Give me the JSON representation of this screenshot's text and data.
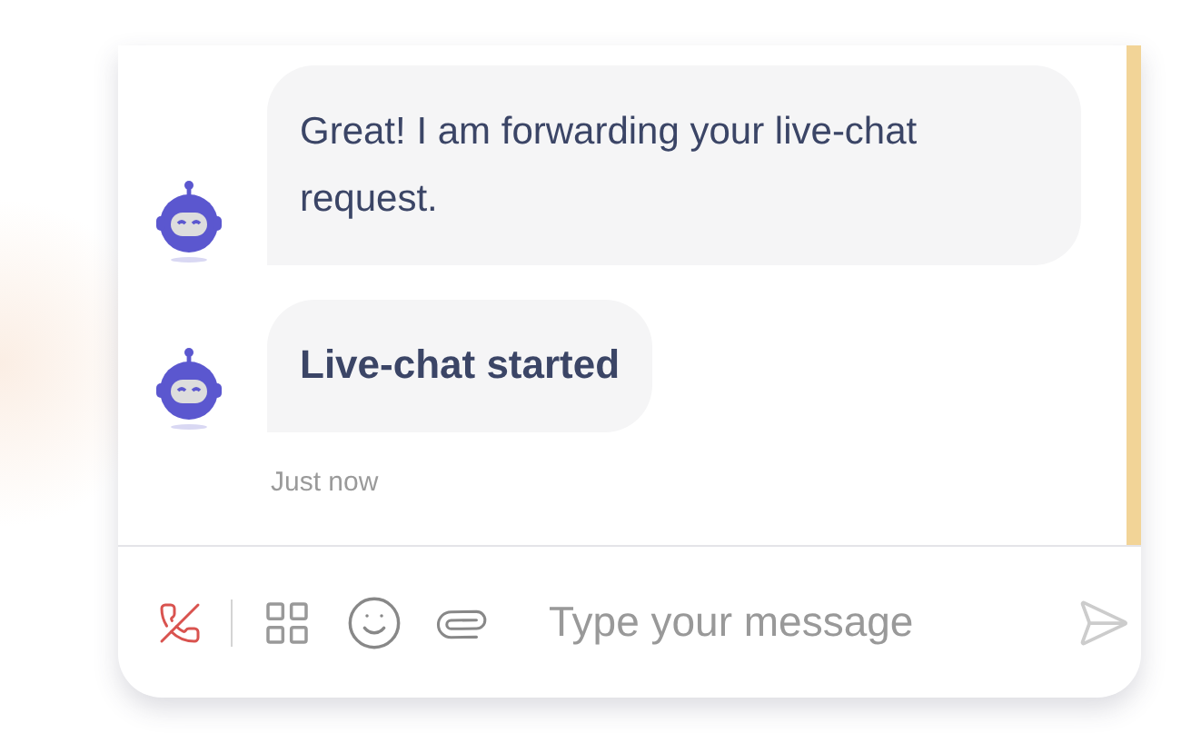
{
  "messages": [
    {
      "kind": "text",
      "text": "Great! I am forwarding your live-chat request."
    },
    {
      "kind": "status",
      "text": "Live-chat started"
    }
  ],
  "timestamp": "Just now",
  "composer": {
    "placeholder": "Type your message"
  }
}
